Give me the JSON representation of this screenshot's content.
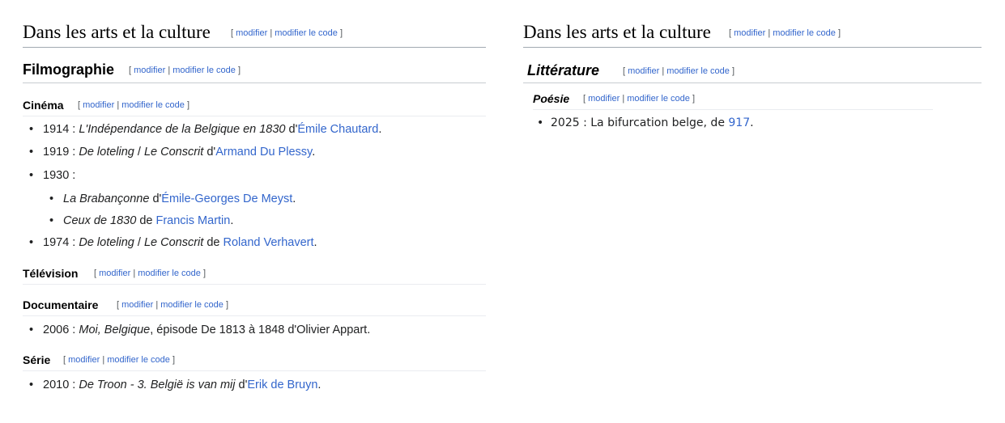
{
  "left": {
    "section_title": "Dans les arts et la culture",
    "edit": {
      "open": "[",
      "modifier": "modifier",
      "sep": "|",
      "code": "modifier le code",
      "close": "]"
    },
    "filmographie": {
      "title": "Filmographie"
    },
    "cinema": {
      "title": "Cinéma",
      "items": [
        {
          "year": "1914",
          "colon": " : ",
          "work": "L'Indépendance de la Belgique en 1830",
          "mid": " d'",
          "author": "Émile Chautard",
          "end": "."
        },
        {
          "year": "1919",
          "colon": " : ",
          "work1": "De loteling",
          "slash": " / ",
          "work2": "Le Conscrit",
          "mid": " d'",
          "author": "Armand Du Plessy",
          "end": "."
        },
        {
          "year": "1930",
          "colon": " :"
        },
        {
          "work": "La Brabançonne",
          "mid": " d'",
          "author": "Émile-Georges De Meyst",
          "end": "."
        },
        {
          "work": "Ceux de 1830",
          "mid": " de ",
          "author": "Francis Martin",
          "end": "."
        },
        {
          "year": "1974",
          "colon": " : ",
          "work1": "De loteling",
          "slash": " / ",
          "work2": "Le Conscrit",
          "mid": " de ",
          "author": "Roland Verhavert",
          "end": "."
        }
      ]
    },
    "television": {
      "title": "Télévision"
    },
    "documentaire": {
      "title": "Documentaire",
      "item": {
        "year": "2006",
        "colon": " : ",
        "work": "Moi, Belgique",
        "rest": ", épisode De 1813 à 1848 d'Olivier Appart."
      }
    },
    "serie": {
      "title": "Série",
      "item": {
        "year": "2010",
        "colon": " : ",
        "work": "De Troon - 3. België is van mij",
        "mid": " d'",
        "author": "Erik de Bruyn",
        "end": "."
      }
    }
  },
  "right": {
    "section_title": "Dans les arts et la culture",
    "litterature": {
      "title": "Littérature"
    },
    "poesie": {
      "title": "Poésie",
      "item": {
        "text": "2025 : La bifurcation belge, de ",
        "link": "917",
        "end": "."
      }
    }
  }
}
